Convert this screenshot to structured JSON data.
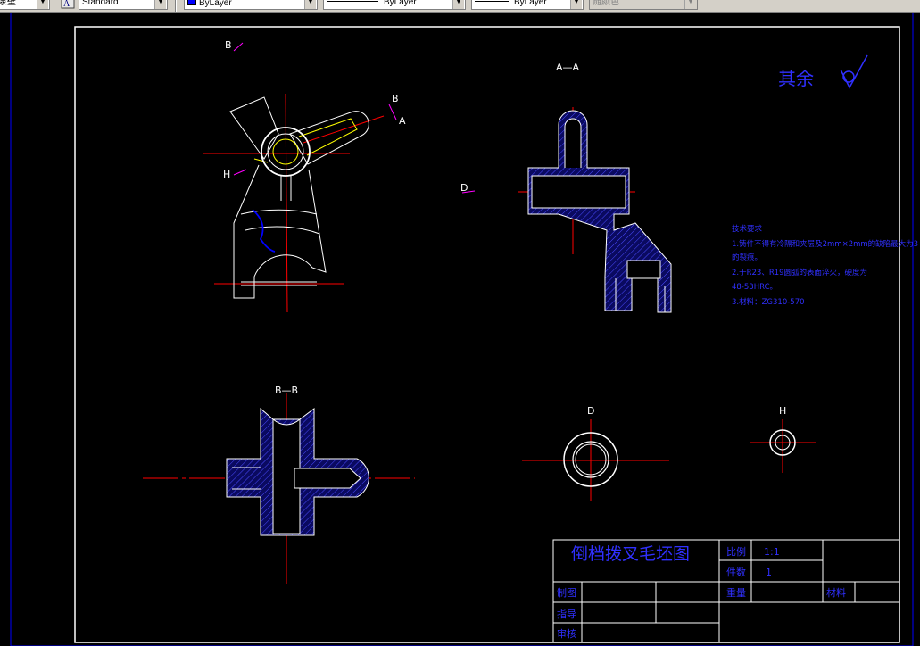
{
  "toolbar": {
    "layer_name": "泵壁",
    "text_style": "Standard",
    "color": "ByLayer",
    "linetype": "ByLayer",
    "lineweight": "ByLayer",
    "plot_style": "随颜色"
  },
  "drawing": {
    "title_block": {
      "drawing_title": "倒档拨叉毛坯图",
      "scale_label": "比例",
      "scale_value": "1:1",
      "quantity_label": "件数",
      "quantity_value": "1",
      "weight_label": "重量",
      "material_label": "材料",
      "drawn_label": "制图",
      "design_label": "指导",
      "check_label": "审核"
    },
    "view_labels": {
      "section_aa": "A—A",
      "section_bb": "B—B",
      "view_d": "D",
      "view_h": "H",
      "mark_b1": "B",
      "mark_b2": "B",
      "mark_a": "A",
      "mark_h": "H",
      "mark_d": "D"
    },
    "roughness_note": "其余",
    "tech_requirements": {
      "heading": "技术要求",
      "lines": [
        "1.铸件不得有冷隔和夹层及2mm×2mm的缺陷最大为3",
        "的裂痕。",
        "2.于R23、R19圆弧的表面淬火，硬度为",
        "48-53HRC。",
        "3.材料：ZG310-570"
      ]
    },
    "colors": {
      "frame": "#ffffff",
      "outline_blue": "#0000ff",
      "centerline": "#ff0000",
      "hatch": "#1a1aa8",
      "text_blue": "#3030ff",
      "hidden_yellow": "#ffff00",
      "mark_magenta": "#ff00ff"
    }
  }
}
